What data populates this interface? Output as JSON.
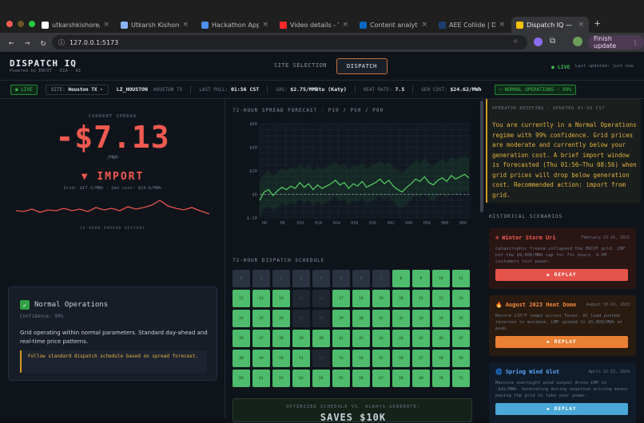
{
  "browser": {
    "tabs": [
      {
        "label": "utkarshkishore/AE",
        "color": "#ffffff"
      },
      {
        "label": "Utkarsh Kishore | P",
        "color": "#8ab4f8"
      },
      {
        "label": "Hackathon App Ide",
        "color": "#4d8ef7"
      },
      {
        "label": "Video details - You",
        "color": "#ff2a2a"
      },
      {
        "label": "Content analytics |",
        "color": "#0a66c2"
      },
      {
        "label": "AEE Collide | Devp",
        "color": "#1d3d6e"
      },
      {
        "label": "Dispatch IQ — Ener",
        "color": "#f5c400"
      }
    ],
    "url": "127.0.0.1:5173",
    "finish": "Finish update"
  },
  "header": {
    "title": "DISPATCH IQ",
    "subtitle": "Powered by ERCOT · EIA · AI",
    "tab_site": "SITE SELECTION",
    "tab_dispatch": "DISPATCH",
    "live": "LIVE",
    "updated": "Last updated: just now"
  },
  "status": {
    "live": "● LIVE",
    "site_prefix": "SITE:",
    "site": "Houston TX",
    "node": "LZ_HOUSTON",
    "node_loc": "HOUSTON TX",
    "last_pull_label": "LAST PULL:",
    "last_pull": "01:56 CST",
    "gas_label": "GAS:",
    "gas": "$2.75/MMBtu (Katy)",
    "heat_label": "HEAT RATE:",
    "heat": "7.5",
    "gen_label": "GEN COST:",
    "gen": "$24.62/MWh",
    "normal": "NORMAL OPERATIONS · 99%"
  },
  "spread": {
    "label": "CURRENT SPREAD",
    "value": "-$7.13",
    "unit": "/MWh",
    "direction": "▼ IMPORT",
    "detail": "Grid: $17.5/MWh · Gen cost: $24.6/MWh",
    "history_label": "24-HOUR SPREAD HISTORY"
  },
  "ops": {
    "title": "Normal Operations",
    "confidence": "Confidence: 99%",
    "description": "Grid operating within normal parameters. Standard day-ahead and real-time price patterns.",
    "action": "Follow standard dispatch schedule based on spread forecast."
  },
  "forecast": {
    "title": "72-HOUR SPREAD FORECAST · P10 / P50 / P90"
  },
  "chart_data": {
    "type": "line",
    "title": "72-HOUR SPREAD FORECAST · P10 / P50 / P90",
    "x": [
      "H0",
      "H6",
      "H12",
      "H18",
      "H24",
      "H30",
      "H36",
      "H42",
      "H48",
      "H54",
      "H60",
      "H66"
    ],
    "yticks": [
      "$60",
      "$40",
      "$20",
      "$0",
      "$-20"
    ],
    "ylim": [
      -20,
      60
    ],
    "series": [
      {
        "name": "P50",
        "values": [
          -5,
          2,
          4,
          -1,
          3,
          6,
          4,
          7,
          5,
          10,
          6,
          9,
          4,
          8,
          5,
          7,
          9,
          12,
          8,
          10,
          5,
          9,
          7,
          11,
          6,
          8,
          10,
          13,
          9,
          12,
          7,
          4,
          2,
          6,
          9,
          13,
          11,
          15,
          10,
          8,
          12,
          14,
          11,
          16,
          13,
          15,
          17,
          14
        ]
      }
    ]
  },
  "schedule": {
    "title": "72-HOUR DISPATCH SCHEDULE",
    "cells": [
      {
        "n": "0",
        "s": "d"
      },
      {
        "n": "1",
        "s": "d"
      },
      {
        "n": "2",
        "s": "d"
      },
      {
        "n": "3",
        "s": "d"
      },
      {
        "n": "4",
        "s": "d"
      },
      {
        "n": "5",
        "s": "d"
      },
      {
        "n": "6",
        "s": "d"
      },
      {
        "n": "7",
        "s": "d"
      },
      {
        "n": "8",
        "s": "g"
      },
      {
        "n": "9",
        "s": "g"
      },
      {
        "n": "10",
        "s": "g"
      },
      {
        "n": "11",
        "s": "g"
      },
      {
        "n": "12",
        "s": "g"
      },
      {
        "n": "13",
        "s": "g"
      },
      {
        "n": "14",
        "s": "g"
      },
      {
        "n": "15",
        "s": "d2"
      },
      {
        "n": "16",
        "s": "d2"
      },
      {
        "n": "17",
        "s": "g"
      },
      {
        "n": "18",
        "s": "g"
      },
      {
        "n": "19",
        "s": "g"
      },
      {
        "n": "20",
        "s": "g"
      },
      {
        "n": "21",
        "s": "g"
      },
      {
        "n": "22",
        "s": "g"
      },
      {
        "n": "23",
        "s": "g"
      },
      {
        "n": "24",
        "s": "g"
      },
      {
        "n": "25",
        "s": "g"
      },
      {
        "n": "26",
        "s": "g"
      },
      {
        "n": "27",
        "s": "d2"
      },
      {
        "n": "28",
        "s": "d2"
      },
      {
        "n": "29",
        "s": "g"
      },
      {
        "n": "30",
        "s": "g"
      },
      {
        "n": "31",
        "s": "g"
      },
      {
        "n": "32",
        "s": "g"
      },
      {
        "n": "33",
        "s": "g"
      },
      {
        "n": "34",
        "s": "g"
      },
      {
        "n": "35",
        "s": "g"
      },
      {
        "n": "36",
        "s": "g"
      },
      {
        "n": "37",
        "s": "g"
      },
      {
        "n": "38",
        "s": "g"
      },
      {
        "n": "39",
        "s": "g"
      },
      {
        "n": "40",
        "s": "g"
      },
      {
        "n": "41",
        "s": "g"
      },
      {
        "n": "42",
        "s": "g"
      },
      {
        "n": "43",
        "s": "g"
      },
      {
        "n": "44",
        "s": "g"
      },
      {
        "n": "45",
        "s": "g"
      },
      {
        "n": "46",
        "s": "g"
      },
      {
        "n": "47",
        "s": "g"
      },
      {
        "n": "48",
        "s": "g"
      },
      {
        "n": "49",
        "s": "g"
      },
      {
        "n": "50",
        "s": "g"
      },
      {
        "n": "51",
        "s": "g"
      },
      {
        "n": "52",
        "s": "d2"
      },
      {
        "n": "53",
        "s": "g"
      },
      {
        "n": "54",
        "s": "g"
      },
      {
        "n": "55",
        "s": "g"
      },
      {
        "n": "56",
        "s": "g"
      },
      {
        "n": "57",
        "s": "g"
      },
      {
        "n": "58",
        "s": "g"
      },
      {
        "n": "59",
        "s": "g"
      },
      {
        "n": "60",
        "s": "g"
      },
      {
        "n": "61",
        "s": "g"
      },
      {
        "n": "62",
        "s": "g"
      },
      {
        "n": "63",
        "s": "g"
      },
      {
        "n": "64",
        "s": "g"
      },
      {
        "n": "65",
        "s": "g"
      },
      {
        "n": "66",
        "s": "g"
      },
      {
        "n": "67",
        "s": "g"
      },
      {
        "n": "68",
        "s": "g"
      },
      {
        "n": "69",
        "s": "g"
      },
      {
        "n": "70",
        "s": "g"
      },
      {
        "n": "71",
        "s": "g"
      }
    ]
  },
  "optimized": {
    "label": "OPTIMIZED SCHEDULE VS. ALWAYS-GENERATE:",
    "value": "SAVES $10K"
  },
  "briefing": {
    "header": "OPERATOR BRIEFING · UPDATED 01:56 CST",
    "text": "You are currently in a Normal Operations regime with 99% confidence. Grid prices are moderate and currently below your generation cost. A brief import window is forecasted (Thu 01:56–Thu 08:56) when grid prices will drop below generation cost. Recommended action: import from grid."
  },
  "history": {
    "title": "HISTORICAL SCENARIOS",
    "items": [
      {
        "icon": "❄",
        "title": "Winter Storm Uri",
        "date": "February 13-16, 2021",
        "desc": "Catastrophic freeze collapsed the ERCOT grid. LMP hit the $9,000/MWh cap for 72+ hours. 4.5M customers lost power.",
        "btn": "▶ REPLAY",
        "color": "#f05a50",
        "bg": "#2a1515",
        "btnc": "#e5534b"
      },
      {
        "icon": "🔥",
        "title": "August 2023 Heat Dome",
        "date": "August 10-19, 2023",
        "desc": "Record 110°F temps across Texas. AC load pushed reserves to minimum. LMP spiked to $5,000/MWh at peak.",
        "btn": "▶ REPLAY",
        "color": "#f0883e",
        "bg": "#2a1b10",
        "btnc": "#ea8033"
      },
      {
        "icon": "🌀",
        "title": "Spring Wind Glut",
        "date": "April 12-13, 2024",
        "desc": "Massive overnight wind output drove LMP to -$42/MWh. Generating during negative pricing means paying the grid to take your power.",
        "btn": "▶ REPLAY",
        "color": "#58a6ff",
        "bg": "#111c2a",
        "btnc": "#4aa8d8"
      }
    ]
  }
}
